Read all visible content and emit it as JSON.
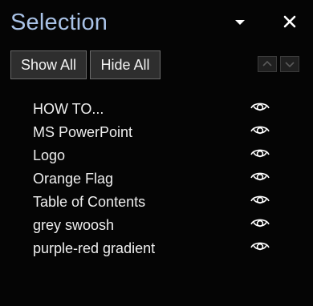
{
  "pane": {
    "title": "Selection",
    "menu_icon": "chevron-down-icon",
    "close_icon": "close-icon"
  },
  "toolbar": {
    "show_all_label": "Show All",
    "hide_all_label": "Hide All",
    "bring_forward_icon": "chevron-up-icon",
    "send_backward_icon": "chevron-down-icon"
  },
  "items": [
    {
      "label": "HOW TO...",
      "visible": true
    },
    {
      "label": "MS PowerPoint",
      "visible": true
    },
    {
      "label": "Logo",
      "visible": true
    },
    {
      "label": "Orange Flag",
      "visible": true
    },
    {
      "label": "Table of Contents",
      "visible": true
    },
    {
      "label": "grey swoosh",
      "visible": true
    },
    {
      "label": "purple-red gradient",
      "visible": true
    }
  ],
  "colors": {
    "background": "#050505",
    "title": "#a9c2e6",
    "button_bg": "#2e2e2e",
    "button_border": "#6b6b6b",
    "text": "#efefef"
  }
}
